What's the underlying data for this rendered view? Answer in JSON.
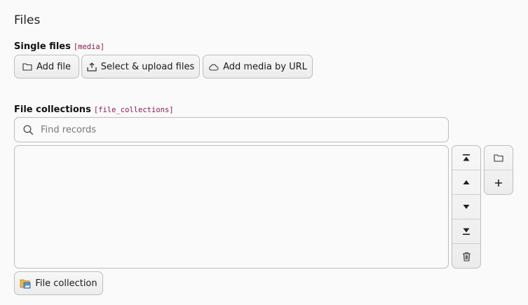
{
  "section": {
    "title": "Files"
  },
  "single_files": {
    "label": "Single files",
    "code": "[media]",
    "buttons": {
      "add_file": "Add file",
      "select_upload": "Select & upload files",
      "add_media_url": "Add media by URL"
    }
  },
  "file_collections": {
    "label": "File collections",
    "code": "[file_collections]",
    "search_placeholder": "Find records",
    "controls": [
      "move-to-top-icon",
      "move-up-icon",
      "move-down-icon",
      "move-to-bottom-icon",
      "trash-icon"
    ],
    "side_controls": [
      "folder-icon",
      "plus-icon"
    ],
    "add_collection_label": "File collection"
  }
}
